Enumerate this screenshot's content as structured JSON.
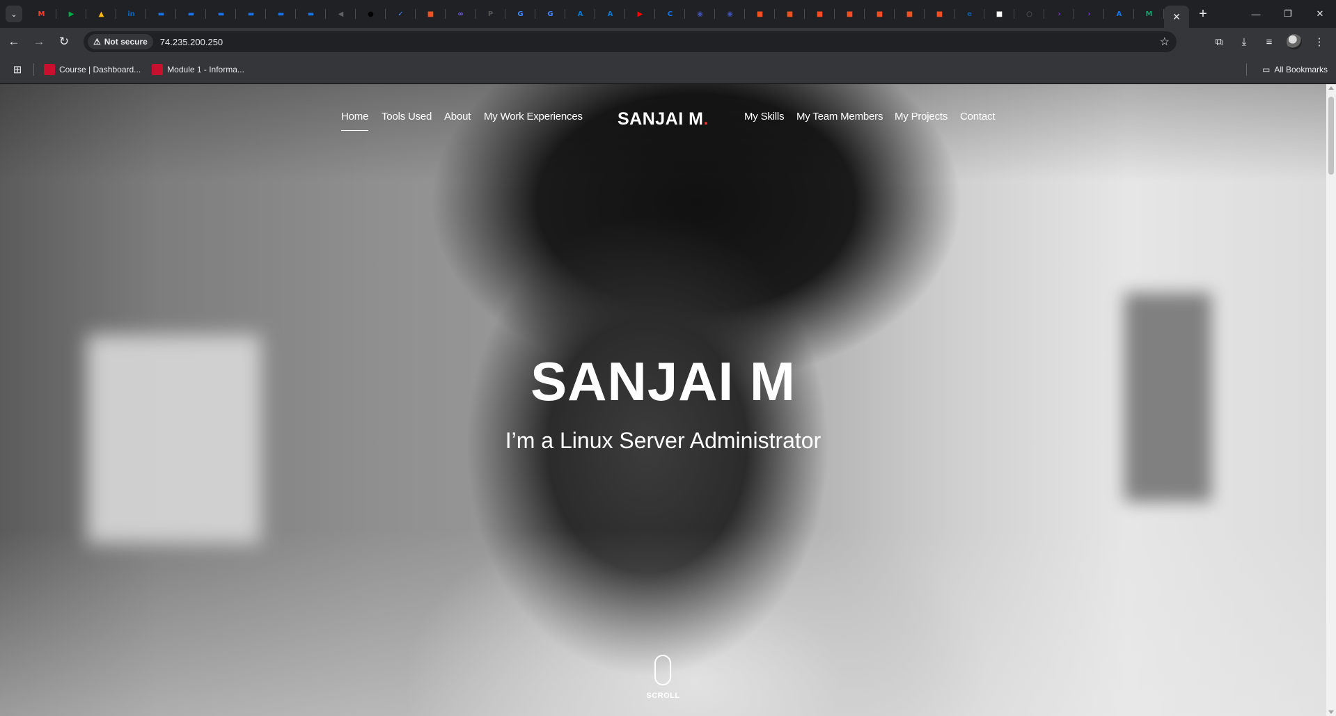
{
  "browser": {
    "security_label": "Not secure",
    "url": "74.235.200.250",
    "tab_close_glyph": "✕",
    "pinned_tabs": [
      {
        "icon": "gmail-icon",
        "glyph": "M",
        "color": "#ea4335"
      },
      {
        "icon": "meet-icon",
        "glyph": "▶",
        "color": "#00ac47"
      },
      {
        "icon": "drive-icon",
        "glyph": "▲",
        "color": "#fbbc04"
      },
      {
        "icon": "linkedin-icon",
        "glyph": "in",
        "color": "#0a66c2"
      },
      {
        "icon": "site-icon",
        "glyph": "▬",
        "color": "#1a73e8"
      },
      {
        "icon": "site-icon",
        "glyph": "▬",
        "color": "#1a73e8"
      },
      {
        "icon": "site-icon",
        "glyph": "▬",
        "color": "#1a73e8"
      },
      {
        "icon": "site-icon",
        "glyph": "▬",
        "color": "#1a73e8"
      },
      {
        "icon": "site-icon",
        "glyph": "▬",
        "color": "#1a73e8"
      },
      {
        "icon": "site-icon",
        "glyph": "▬",
        "color": "#1a73e8"
      },
      {
        "icon": "speaker-icon",
        "glyph": "◀",
        "color": "#5f6368"
      },
      {
        "icon": "github-icon",
        "glyph": "●",
        "color": "#000000"
      },
      {
        "icon": "check-icon",
        "glyph": "✓",
        "color": "#4285f4"
      },
      {
        "icon": "microsoft-icon",
        "glyph": "■",
        "color": "#f25022"
      },
      {
        "icon": "infinity-icon",
        "glyph": "∞",
        "color": "#7b61ff"
      },
      {
        "icon": "pdf-icon",
        "glyph": "P",
        "color": "#555555"
      },
      {
        "icon": "google-icon",
        "glyph": "G",
        "color": "#4285f4"
      },
      {
        "icon": "google-icon",
        "glyph": "G",
        "color": "#4285f4"
      },
      {
        "icon": "azure-icon",
        "glyph": "A",
        "color": "#0078d4"
      },
      {
        "icon": "azure-icon",
        "glyph": "A",
        "color": "#0078d4"
      },
      {
        "icon": "youtube-icon",
        "glyph": "▶",
        "color": "#ff0000"
      },
      {
        "icon": "chatbot-icon",
        "glyph": "C",
        "color": "#1a73e8"
      },
      {
        "icon": "app-icon",
        "glyph": "◉",
        "color": "#3f51b5"
      },
      {
        "icon": "app-icon",
        "glyph": "◉",
        "color": "#3f51b5"
      },
      {
        "icon": "microsoft-icon",
        "glyph": "■",
        "color": "#f25022"
      },
      {
        "icon": "microsoft-icon",
        "glyph": "■",
        "color": "#f25022"
      },
      {
        "icon": "microsoft-icon",
        "glyph": "■",
        "color": "#f25022"
      },
      {
        "icon": "microsoft-icon",
        "glyph": "■",
        "color": "#f25022"
      },
      {
        "icon": "microsoft-icon",
        "glyph": "■",
        "color": "#f25022"
      },
      {
        "icon": "microsoft-icon",
        "glyph": "■",
        "color": "#f25022"
      },
      {
        "icon": "microsoft-icon",
        "glyph": "■",
        "color": "#f25022"
      },
      {
        "icon": "edge-icon",
        "glyph": "e",
        "color": "#0c59a4"
      },
      {
        "icon": "square-icon",
        "glyph": "■",
        "color": "#ffffff"
      },
      {
        "icon": "circle-icon",
        "glyph": "○",
        "color": "#5f6368"
      },
      {
        "icon": "arrow-icon",
        "glyph": "›",
        "color": "#7b2ff7"
      },
      {
        "icon": "arrow-icon",
        "glyph": "›",
        "color": "#7b2ff7"
      },
      {
        "icon": "a-icon",
        "glyph": "A",
        "color": "#1a73e8"
      },
      {
        "icon": "m-icon",
        "glyph": "M",
        "color": "#00a86b"
      }
    ],
    "bookmarks": [
      {
        "label": "Course | Dashboard..."
      },
      {
        "label": "Module 1 - Informa..."
      }
    ],
    "all_bookmarks_label": "All Bookmarks"
  },
  "site": {
    "nav_left": [
      "Home",
      "Tools Used",
      "About",
      "My Work Experiences"
    ],
    "logo_text": "SANJAI M",
    "logo_dot": ".",
    "nav_right": [
      "My Skills",
      "My Team Members",
      "My Projects",
      "Contact"
    ],
    "hero_title": "SANJAI M",
    "hero_subtitle": "I’m a Linux Server Administrator",
    "scroll_label": "SCROLL",
    "accent_color": "#e8322b"
  }
}
